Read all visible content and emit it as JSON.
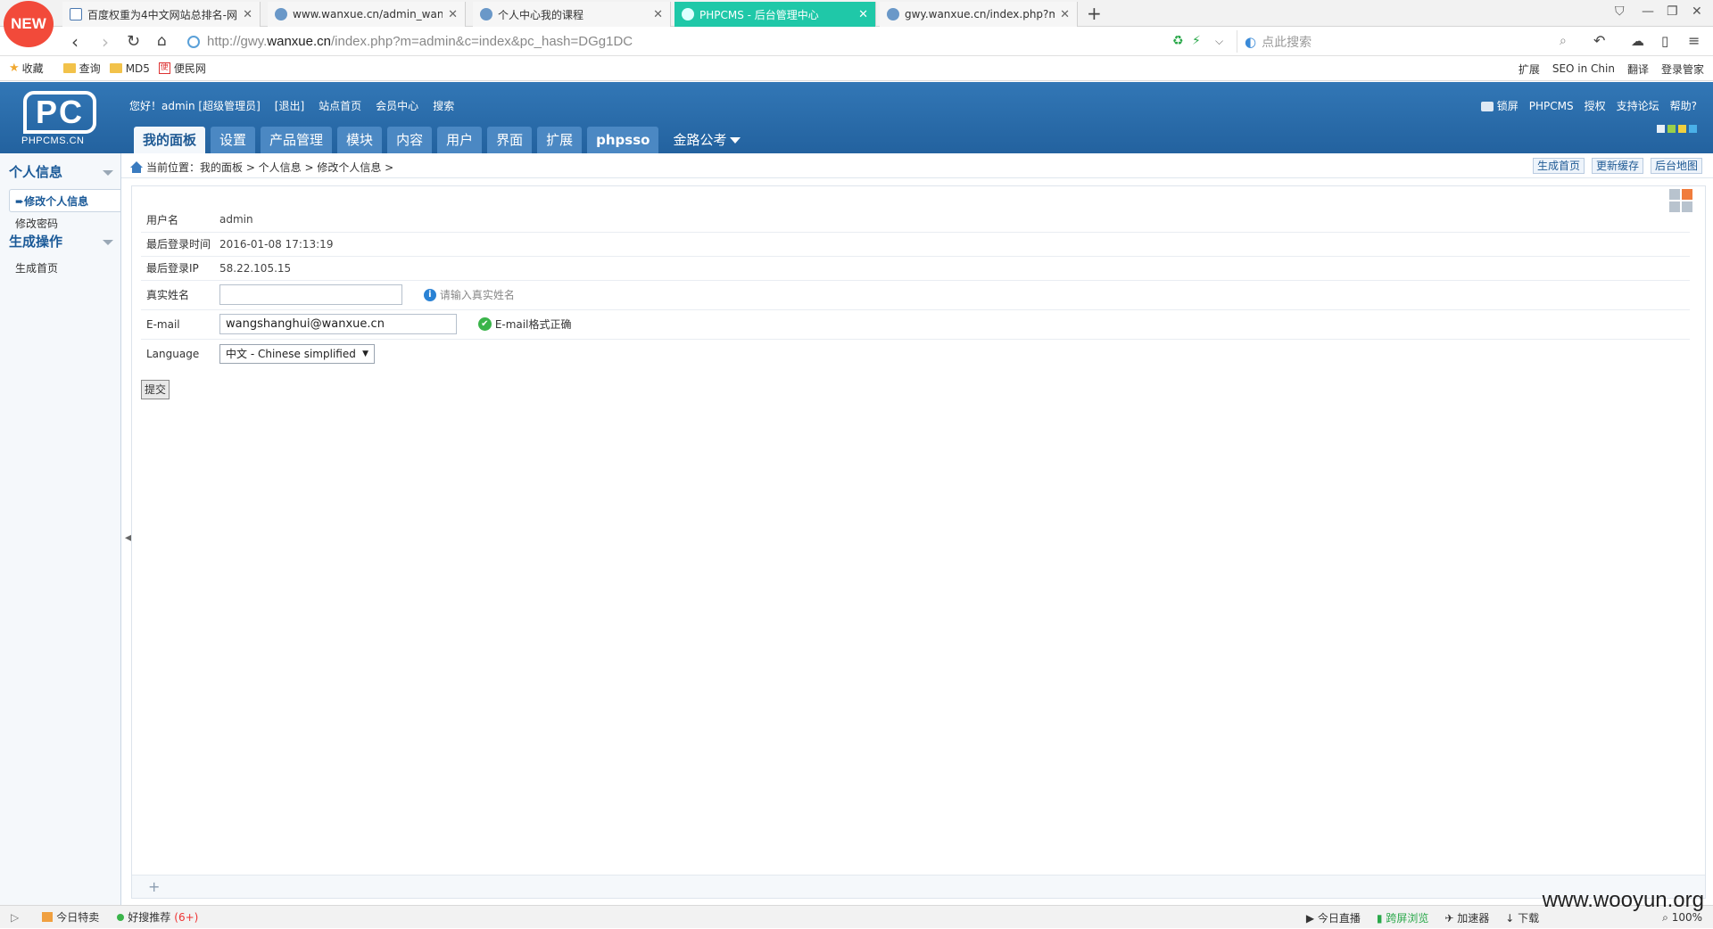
{
  "browser": {
    "new_badge": "NEW",
    "tabs": [
      {
        "title": "百度权重为4中文网站总排名-网"
      },
      {
        "title": "www.wanxue.cn/admin_wanxue"
      },
      {
        "title": "个人中心我的课程"
      },
      {
        "title": "PHPCMS - 后台管理中心"
      },
      {
        "title": "gwy.wanxue.cn/index.php?m="
      }
    ],
    "url_prefix": "http://gwy.",
    "url_host": "wanxue.cn",
    "url_path": "/index.php?m=admin&c=index&pc_hash=DGg1DC",
    "search_placeholder": "点此搜索",
    "bookmarks": [
      "收藏",
      "查询",
      "MD5",
      "便民网"
    ],
    "bookmark_right": [
      "扩展",
      "SEO in Chin",
      "翻译",
      "登录管家"
    ]
  },
  "header": {
    "logo_big": "PC",
    "logo_small": "PHPCMS.CN",
    "greeting": "您好！admin [超级管理员]",
    "logout": "[退出]",
    "site_home": "站点首页",
    "member_center": "会员中心",
    "search": "搜索",
    "right_links": [
      "锁屏",
      "PHPCMS",
      "授权",
      "支持论坛",
      "帮助?"
    ],
    "nav": [
      "我的面板",
      "设置",
      "产品管理",
      "模块",
      "内容",
      "用户",
      "界面",
      "扩展",
      "phpsso",
      "金路公考"
    ],
    "skin_colors": [
      "#e8f0f8",
      "#9ad04a",
      "#f0d040",
      "#4ab0e8"
    ]
  },
  "sidebar": {
    "section1": "个人信息",
    "items1": [
      "修改个人信息",
      "修改密码"
    ],
    "section2": "生成操作",
    "items2": [
      "生成首页"
    ]
  },
  "breadcrumb": {
    "text": "当前位置：我的面板 > 个人信息 > 修改个人信息 >",
    "buttons": [
      "生成首页",
      "更新缓存",
      "后台地图"
    ]
  },
  "form": {
    "rows": [
      {
        "label": "用户名",
        "value": "admin"
      },
      {
        "label": "最后登录时间",
        "value": "2016-01-08 17:13:19"
      },
      {
        "label": "最后登录IP",
        "value": "58.22.105.15"
      }
    ],
    "realname_label": "真实姓名",
    "realname_value": "",
    "realname_hint": "请输入真实姓名",
    "email_label": "E-mail",
    "email_value": "wangshanghui@wanxue.cn",
    "email_hint": "E-mail格式正确",
    "language_label": "Language",
    "language_value": "中文 - Chinese simplified",
    "submit": "提交"
  },
  "statusbar": {
    "items": [
      "今日特卖",
      "好搜推荐",
      "(6+)"
    ],
    "right": [
      "今日直播",
      "跨屏浏览",
      "加速器",
      "下载",
      "100%"
    ]
  },
  "watermark": "www.wooyun.org"
}
